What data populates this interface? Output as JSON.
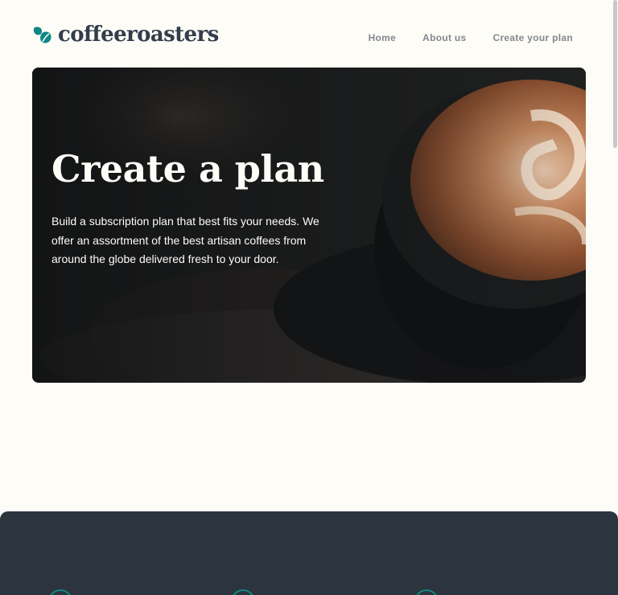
{
  "brand": {
    "name": "coffeeroasters"
  },
  "nav": {
    "items": [
      {
        "label": "Home"
      },
      {
        "label": "About us"
      },
      {
        "label": "Create your plan"
      }
    ]
  },
  "hero": {
    "title": "Create a plan",
    "description": "Build a subscription plan that best fits your needs. We offer an assortment of the best  artisan coffees from around the globe delivered fresh to your door."
  },
  "steps": {
    "count": 3
  },
  "colors": {
    "background": "#FEFCF7",
    "accent": "#0E8784",
    "dark": "#333D4B",
    "nav_text": "#83888F",
    "steps_bg": "#2C343E"
  }
}
